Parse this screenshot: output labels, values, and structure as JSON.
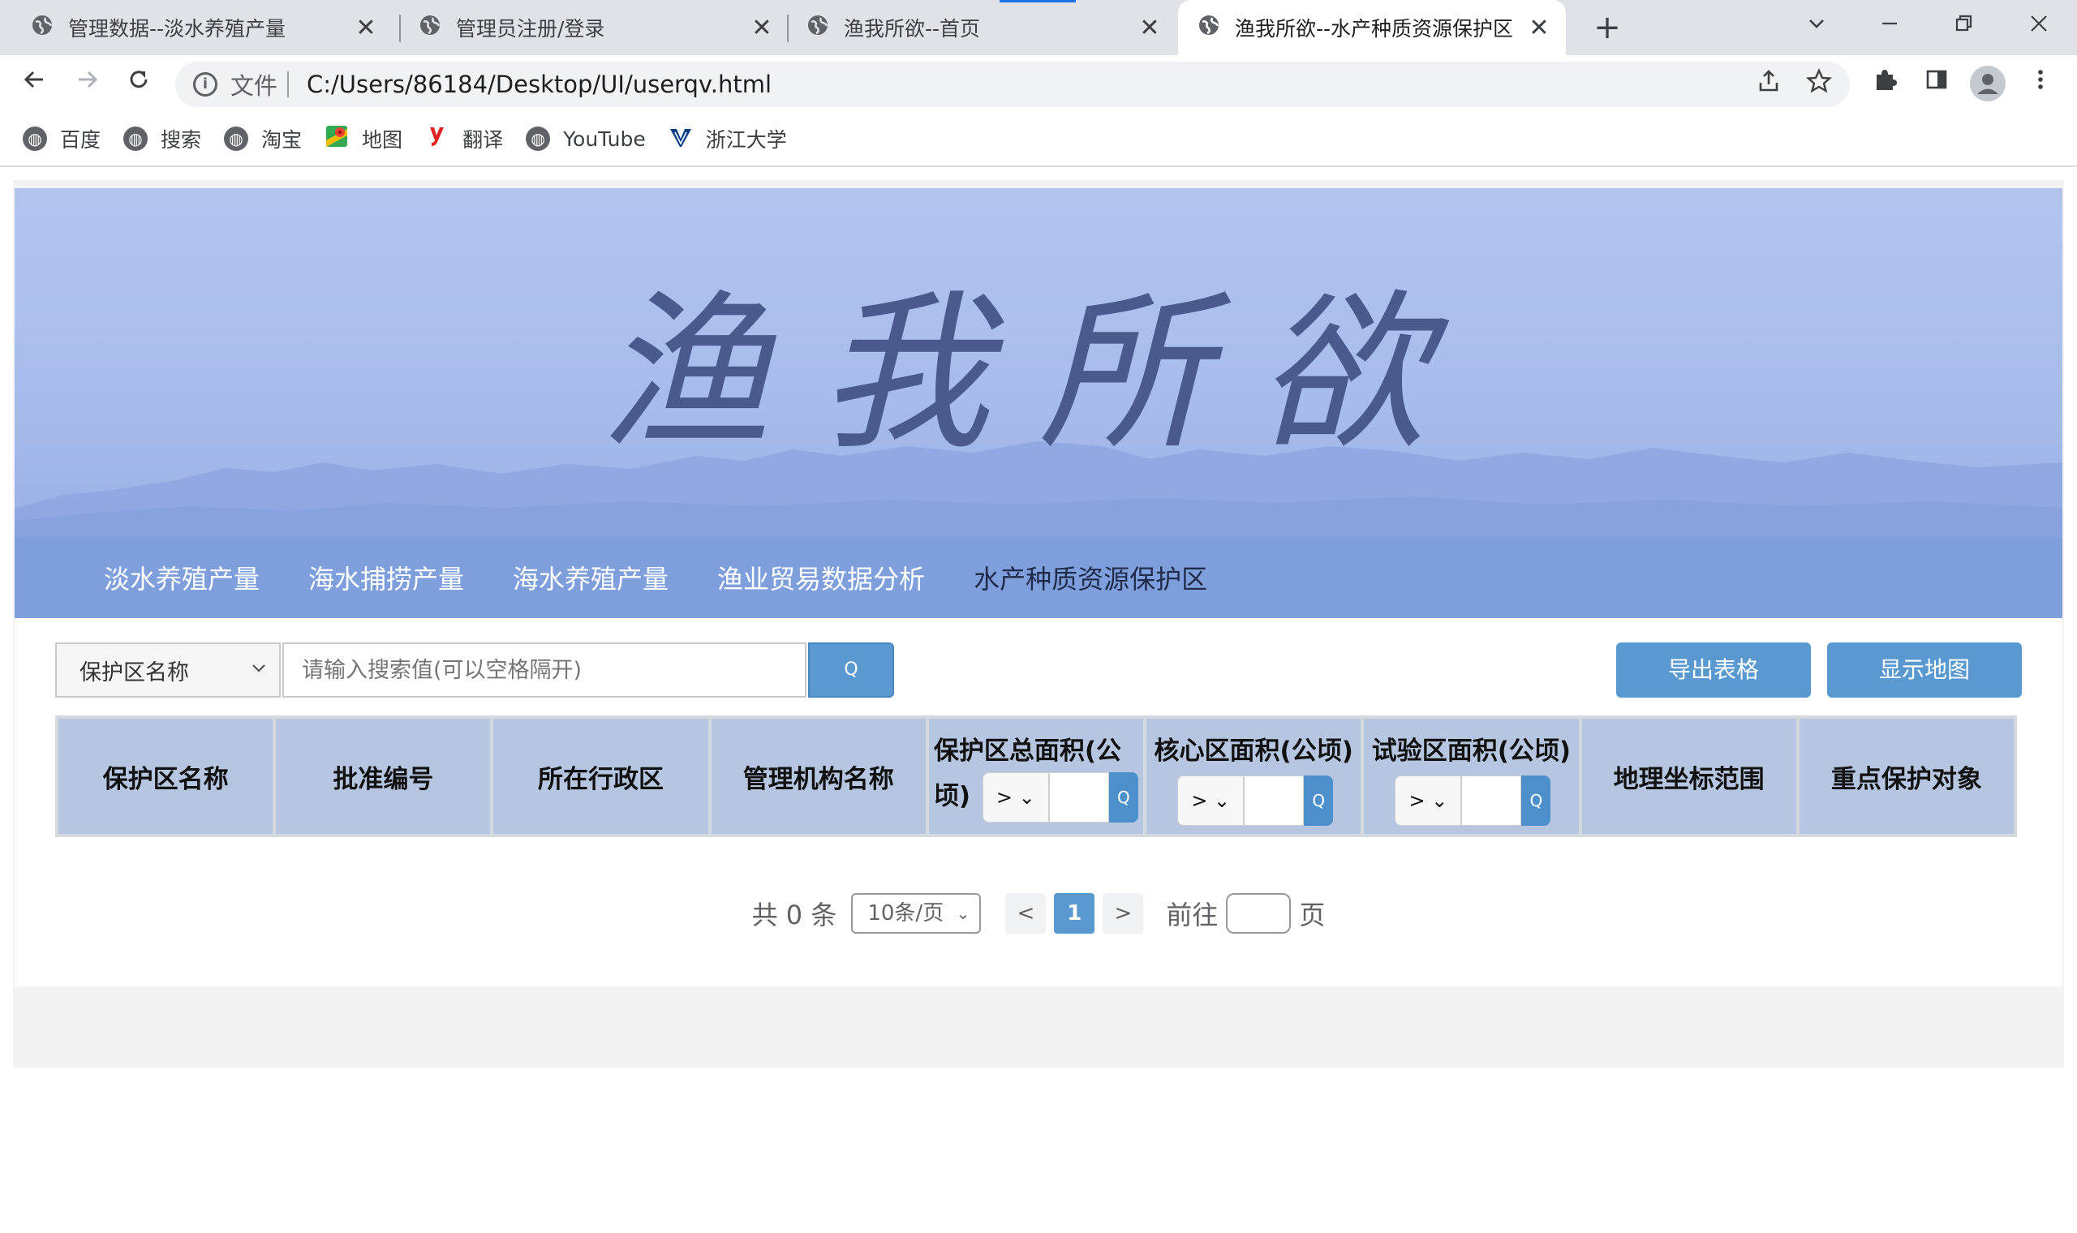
{
  "browser": {
    "tabs": [
      {
        "title": "管理数据--淡水养殖产量",
        "active": false
      },
      {
        "title": "管理员注册/登录",
        "active": false
      },
      {
        "title": "渔我所欲--首页",
        "active": false
      },
      {
        "title": "渔我所欲--水产种质资源保护区",
        "active": true
      }
    ],
    "close_glyph": "✕",
    "new_tab_glyph": "+",
    "address": {
      "scheme_label": "文件",
      "url": "C:/Users/86184/Desktop/UI/userqv.html"
    },
    "bookmarks": [
      {
        "label": "百度",
        "icon": "globe-icon"
      },
      {
        "label": "搜索",
        "icon": "globe-icon"
      },
      {
        "label": "淘宝",
        "icon": "globe-icon"
      },
      {
        "label": "地图",
        "icon": "maps-icon"
      },
      {
        "label": "翻译",
        "icon": "youdao-icon"
      },
      {
        "label": "YouTube",
        "icon": "globe-icon"
      },
      {
        "label": "浙江大学",
        "icon": "zju-icon"
      }
    ]
  },
  "site": {
    "banner_title": "渔我所欲",
    "nav": [
      {
        "label": "淡水养殖产量"
      },
      {
        "label": "海水捕捞产量"
      },
      {
        "label": "海水养殖产量"
      },
      {
        "label": "渔业贸易数据分析"
      },
      {
        "label": "水产种质资源保护区",
        "current": true
      }
    ]
  },
  "search": {
    "field_selected": "保护区名称",
    "placeholder": "请输入搜索值(可以空格隔开)",
    "button_glyph": "Q"
  },
  "actions": {
    "export_label": "导出表格",
    "map_label": "显示地图"
  },
  "table": {
    "columns": [
      {
        "label": "保护区名称"
      },
      {
        "label": "批准编号"
      },
      {
        "label": "所在行政区"
      },
      {
        "label": "管理机构名称"
      },
      {
        "label": "保护区总面积(公顷)",
        "line1": "保护区总面积(公",
        "line2": "顷)",
        "filter_op": ">"
      },
      {
        "label": "核心区面积(公顷)",
        "filter_op": ">"
      },
      {
        "label": "试验区面积(公顷)",
        "filter_op": ">"
      },
      {
        "label": "地理坐标范围"
      },
      {
        "label": "重点保护对象"
      }
    ],
    "filter_button_glyph": "Q",
    "rows": []
  },
  "pagination": {
    "total_label": "共 0 条",
    "page_size": "10条/页",
    "prev": "<",
    "current_page": "1",
    "next": ">",
    "goto_label": "前往",
    "page_unit": "页"
  },
  "colors": {
    "banner": "#a8bcec",
    "navbar": "#7f9fdc",
    "primary_button": "#5a98d0",
    "table_header": "#b7c6e0"
  }
}
